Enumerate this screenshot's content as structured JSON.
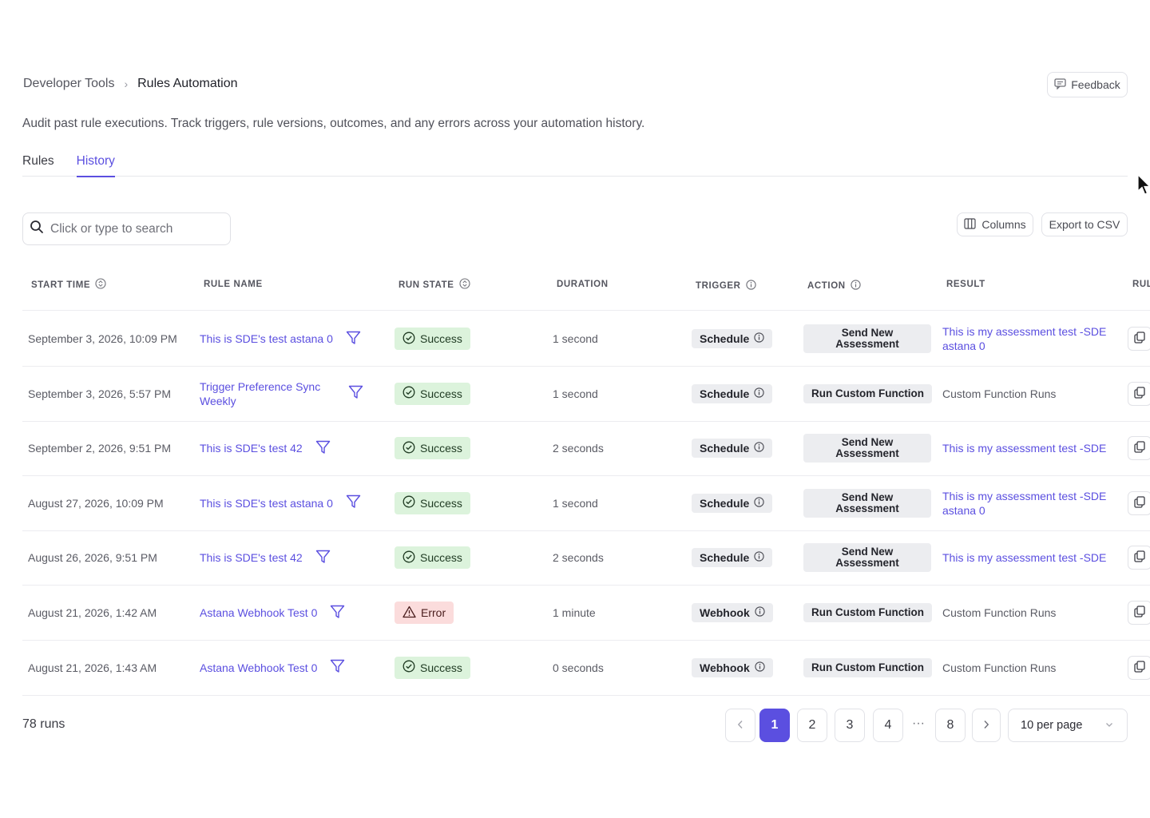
{
  "breadcrumb": {
    "parent": "Developer Tools",
    "separator": "›",
    "current": "Rules Automation"
  },
  "header": {
    "feedback_label": "Feedback"
  },
  "description": "Audit past rule executions. Track triggers, rule versions, outcomes, and any errors across your automation history.",
  "tabs": [
    {
      "label": "Rules",
      "active": false
    },
    {
      "label": "History",
      "active": true
    }
  ],
  "search": {
    "placeholder": "Click or type to search",
    "value": ""
  },
  "toolbar": {
    "columns_label": "Columns",
    "export_label": "Export to CSV"
  },
  "table": {
    "columns": [
      {
        "label": "START TIME",
        "icon": "sort-icon"
      },
      {
        "label": "RULE NAME",
        "icon": ""
      },
      {
        "label": "RUN STATE",
        "icon": "sort-icon"
      },
      {
        "label": "DURATION",
        "icon": ""
      },
      {
        "label": "TRIGGER",
        "icon": "info-icon"
      },
      {
        "label": "ACTION",
        "icon": "info-icon"
      },
      {
        "label": "RESULT",
        "icon": ""
      },
      {
        "label": "RUL",
        "icon": ""
      }
    ],
    "rows": [
      {
        "start_time": "September 3, 2026, 10:09 PM",
        "rule_name": "This is SDE's test astana 0",
        "run_state": "Success",
        "duration": "1 second",
        "trigger": "Schedule",
        "action": "Send New Assessment",
        "result": "This is my assessment test -SDE astana 0",
        "result_type": "link"
      },
      {
        "start_time": "September 3, 2026, 5:57 PM",
        "rule_name": "Trigger Preference Sync Weekly",
        "run_state": "Success",
        "duration": "1 second",
        "trigger": "Schedule",
        "action": "Run Custom Function",
        "result": "Custom Function Runs",
        "result_type": "plain"
      },
      {
        "start_time": "September 2, 2026, 9:51 PM",
        "rule_name": "This is SDE's test 42",
        "run_state": "Success",
        "duration": "2 seconds",
        "trigger": "Schedule",
        "action": "Send New Assessment",
        "result": "This is my assessment test -SDE",
        "result_type": "link"
      },
      {
        "start_time": "August 27, 2026, 10:09 PM",
        "rule_name": "This is SDE's test astana 0",
        "run_state": "Success",
        "duration": "1 second",
        "trigger": "Schedule",
        "action": "Send New Assessment",
        "result": "This is my assessment test -SDE astana 0",
        "result_type": "link"
      },
      {
        "start_time": "August 26, 2026, 9:51 PM",
        "rule_name": "This is SDE's test 42",
        "run_state": "Success",
        "duration": "2 seconds",
        "trigger": "Schedule",
        "action": "Send New Assessment",
        "result": "This is my assessment test -SDE",
        "result_type": "link"
      },
      {
        "start_time": "August 21, 2026, 1:42 AM",
        "rule_name": "Astana Webhook Test 0",
        "run_state": "Error",
        "duration": "1 minute",
        "trigger": "Webhook",
        "action": "Run Custom Function",
        "result": "Custom Function Runs",
        "result_type": "plain"
      },
      {
        "start_time": "August 21, 2026, 1:43 AM",
        "rule_name": "Astana Webhook Test 0",
        "run_state": "Success",
        "duration": "0 seconds",
        "trigger": "Webhook",
        "action": "Run Custom Function",
        "result": "Custom Function Runs",
        "result_type": "plain"
      }
    ]
  },
  "footer": {
    "runs_count": "78 runs",
    "pages": [
      "1",
      "2",
      "3",
      "4",
      "8"
    ],
    "current_page": "1",
    "ellipsis": "···",
    "per_page": "10 per page"
  },
  "colors": {
    "accent": "#5b4fe0",
    "success_bg": "#dcf3dc",
    "error_bg": "#fbdcdc",
    "chip_bg": "#ecedf0"
  }
}
